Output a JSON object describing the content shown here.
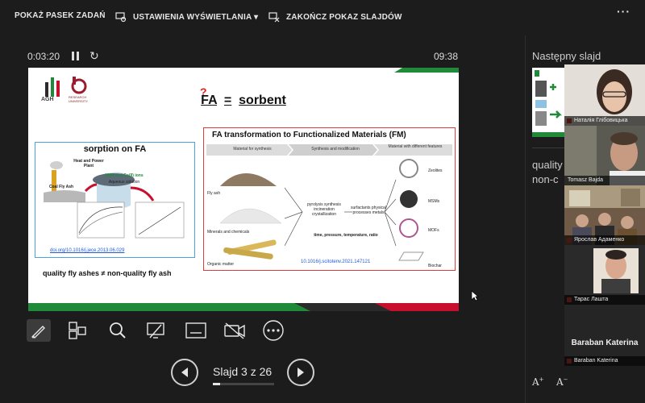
{
  "toolbar": {
    "show_taskbar": "POKAŻ PASEK ZADAŃ",
    "display_settings": "USTAWIENIA WYŚWIETLANIA ▾",
    "end_show": "ZAKOŃCZ POKAZ SLAJDÓW",
    "more": "···"
  },
  "presenter": {
    "elapsed": "0:03:20",
    "clock": "09:38"
  },
  "slide": {
    "title_left": "FA",
    "title_op": "=",
    "title_right": "sorbent",
    "question_mark": "?",
    "agh_label": "AGH",
    "ru_label": "RESEARCH UNIVERSITY",
    "left_box": {
      "title": "sorption on FA",
      "doi": "doi.org/10.1016/j.jece.2013.06.029",
      "heat_plant": "Heat and Power Plant",
      "coal_ash": "Coal Fly Ash",
      "coal_fly_ash": "Coal Fly Ash",
      "ions": "Ni(II) and Co(II) ions",
      "solution": "Aqueous solution"
    },
    "note": "quality fly ashes ≠ non-quality fly ash",
    "right_box": {
      "title": "FA transformation to Functionalized Materials (FM)",
      "step1": "Material for synthesis",
      "step2": "Synthesis and modification",
      "step3": "Material with different features",
      "src_fly": "Fly ash",
      "src_min": "Minerals and chemicals",
      "src_org": "Organic matter",
      "proc1": "pyrolysis synthesis incineration crystallization",
      "proc2": "surfactants physical processes metals",
      "cond": "time, pressure, temperature, ratio",
      "out1": "Zeolites",
      "out2": "MSMs",
      "out3": "MOFs",
      "out4": "Biochar",
      "doi": "10.1016/j.scitotenv.2021.147121"
    }
  },
  "slide_counter": "Slajd 3 z 26",
  "progress": 0.115,
  "right_panel": {
    "next_label": "Następny slajd",
    "notes_line1": "quality",
    "notes_line2": "non-c"
  },
  "participants": [
    {
      "name": "Наталія Глібовицька"
    },
    {
      "name": "Tomasz Bajda"
    },
    {
      "name": "Ярослав Адаменко"
    },
    {
      "name": "Тарас Лашта"
    },
    {
      "name": "Baraban Katerina",
      "big_name": "Baraban Katerina"
    }
  ],
  "font_controls": {
    "increase": "A",
    "decrease": "A"
  },
  "colors": {
    "accent_green": "#1e8a3a",
    "accent_red": "#c8102e",
    "bg": "#1c1c1c"
  }
}
